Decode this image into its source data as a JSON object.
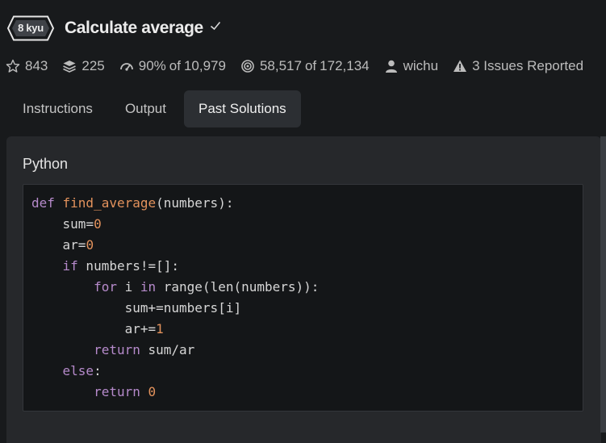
{
  "header": {
    "rank": "8 kyu",
    "title": "Calculate average"
  },
  "stats": {
    "stars": "843",
    "collections": "225",
    "satisfaction": "90%",
    "of_word": "of",
    "votes": "10,979",
    "completed": "58,517",
    "attempted": "172,134",
    "author": "wichu",
    "issues": "3 Issues Reported"
  },
  "tabs": [
    {
      "label": "Instructions",
      "active": false
    },
    {
      "label": "Output",
      "active": false
    },
    {
      "label": "Past Solutions",
      "active": true
    }
  ],
  "solution": {
    "language": "Python",
    "code_lines": [
      [
        {
          "t": "def ",
          "c": "kw"
        },
        {
          "t": "find_average",
          "c": "fn"
        },
        {
          "t": "(numbers):",
          "c": "pl"
        }
      ],
      [
        {
          "t": "    sum",
          "c": "pl"
        },
        {
          "t": "=",
          "c": "op"
        },
        {
          "t": "0",
          "c": "num"
        }
      ],
      [
        {
          "t": "    ar",
          "c": "pl"
        },
        {
          "t": "=",
          "c": "op"
        },
        {
          "t": "0",
          "c": "num"
        }
      ],
      [
        {
          "t": "    ",
          "c": "pl"
        },
        {
          "t": "if",
          "c": "kw"
        },
        {
          "t": " numbers!=[]:",
          "c": "pl"
        }
      ],
      [
        {
          "t": "        ",
          "c": "pl"
        },
        {
          "t": "for",
          "c": "kw"
        },
        {
          "t": " i ",
          "c": "pl"
        },
        {
          "t": "in",
          "c": "kw"
        },
        {
          "t": " range(len(numbers)):",
          "c": "pl"
        }
      ],
      [
        {
          "t": "            sum+=numbers[i]",
          "c": "pl"
        }
      ],
      [
        {
          "t": "            ar+=",
          "c": "pl"
        },
        {
          "t": "1",
          "c": "num"
        }
      ],
      [
        {
          "t": "        ",
          "c": "pl"
        },
        {
          "t": "return",
          "c": "kw"
        },
        {
          "t": " sum/ar",
          "c": "pl"
        }
      ],
      [
        {
          "t": "    ",
          "c": "pl"
        },
        {
          "t": "else",
          "c": "kw"
        },
        {
          "t": ":",
          "c": "pl"
        }
      ],
      [
        {
          "t": "        ",
          "c": "pl"
        },
        {
          "t": "return",
          "c": "kw"
        },
        {
          "t": " ",
          "c": "pl"
        },
        {
          "t": "0",
          "c": "num"
        }
      ]
    ]
  },
  "colors": {
    "background": "#181a1c",
    "panel": "#26282b",
    "code_background": "#141618",
    "keyword": "#b68acb",
    "function": "#e3925c",
    "number": "#e3925c"
  },
  "icons": {
    "rank": "hexagon-badge-icon",
    "title_status": "checkmark-icon",
    "stars": "star-icon",
    "collections": "layers-stack-icon",
    "satisfaction": "gauge-icon",
    "completed": "target-icon",
    "author": "user-icon",
    "issues": "warning-triangle-icon"
  }
}
